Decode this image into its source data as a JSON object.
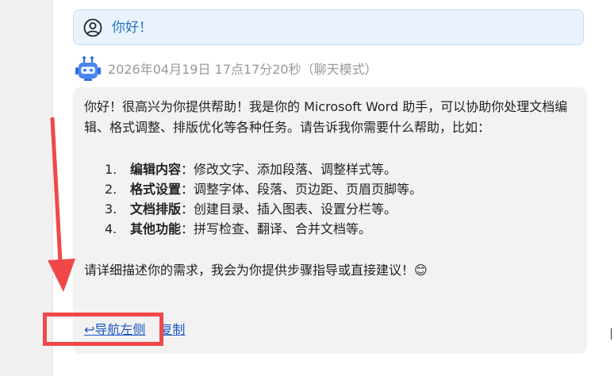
{
  "user_message": {
    "text": "你好！",
    "avatar_icon": "user-circle-icon",
    "bubble_color": "#eaf3fd",
    "text_color": "#1e73c8"
  },
  "bot_message": {
    "avatar_icon": "robot-icon",
    "timestamp": "2026年04月19日 17点17分20秒（聊天模式）",
    "intro": "你好！很高兴为你提供帮助！我是你的 Microsoft Word 助手，可以协助你处理文档编辑、格式调整、排版优化等各种任务。请告诉我你需要什么帮助，比如：",
    "items": [
      {
        "num": "1.",
        "term": "编辑内容",
        "desc": "：修改文字、添加段落、调整样式等。"
      },
      {
        "num": "2.",
        "term": "格式设置",
        "desc": "：调整字体、段落、页边距、页眉页脚等。"
      },
      {
        "num": "3.",
        "term": "文档排版",
        "desc": "：创建目录、插入图表、设置分栏等。"
      },
      {
        "num": "4.",
        "term": "其他功能",
        "desc": "：拼写检查、翻译、合并文档等。"
      }
    ],
    "outro": "请详细描述你的需求，我会为你提供步骤指导或直接建议！😊",
    "actions": {
      "nav_left": "↩导航左侧",
      "copy": "复制"
    },
    "bubble_color": "#f2f2f2",
    "link_color": "#1a56c5"
  },
  "annotation": {
    "color": "#f0484a"
  }
}
